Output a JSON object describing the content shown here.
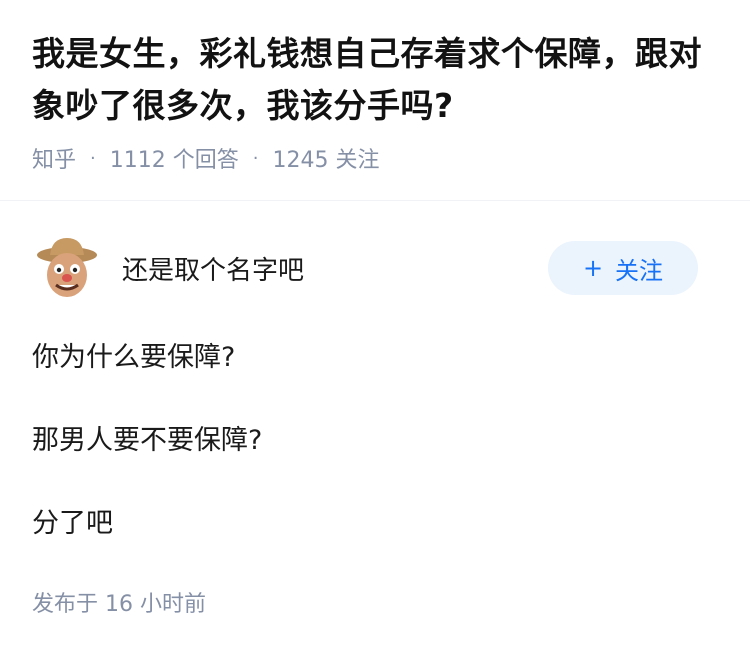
{
  "question": {
    "title": "我是女生，彩礼钱想自己存着求个保障，跟对象吵了很多次，我该分手吗?",
    "source": "知乎",
    "answers_count": "1112",
    "answers_label": "个回答",
    "followers_count": "1245",
    "followers_label": "关注"
  },
  "answer": {
    "author_name": "还是取个名字吧",
    "avatar_icon": "cartoon-man-avatar",
    "follow_plus": "+",
    "follow_label": "关注",
    "paragraphs": [
      "你为什么要保障?",
      "那男人要不要保障?",
      "分了吧"
    ],
    "publish_prefix": "发布于",
    "publish_time": "16 小时前"
  },
  "colors": {
    "accent": "#1772f6",
    "follow_bg": "#ebf3fd",
    "meta": "#8590a6"
  }
}
